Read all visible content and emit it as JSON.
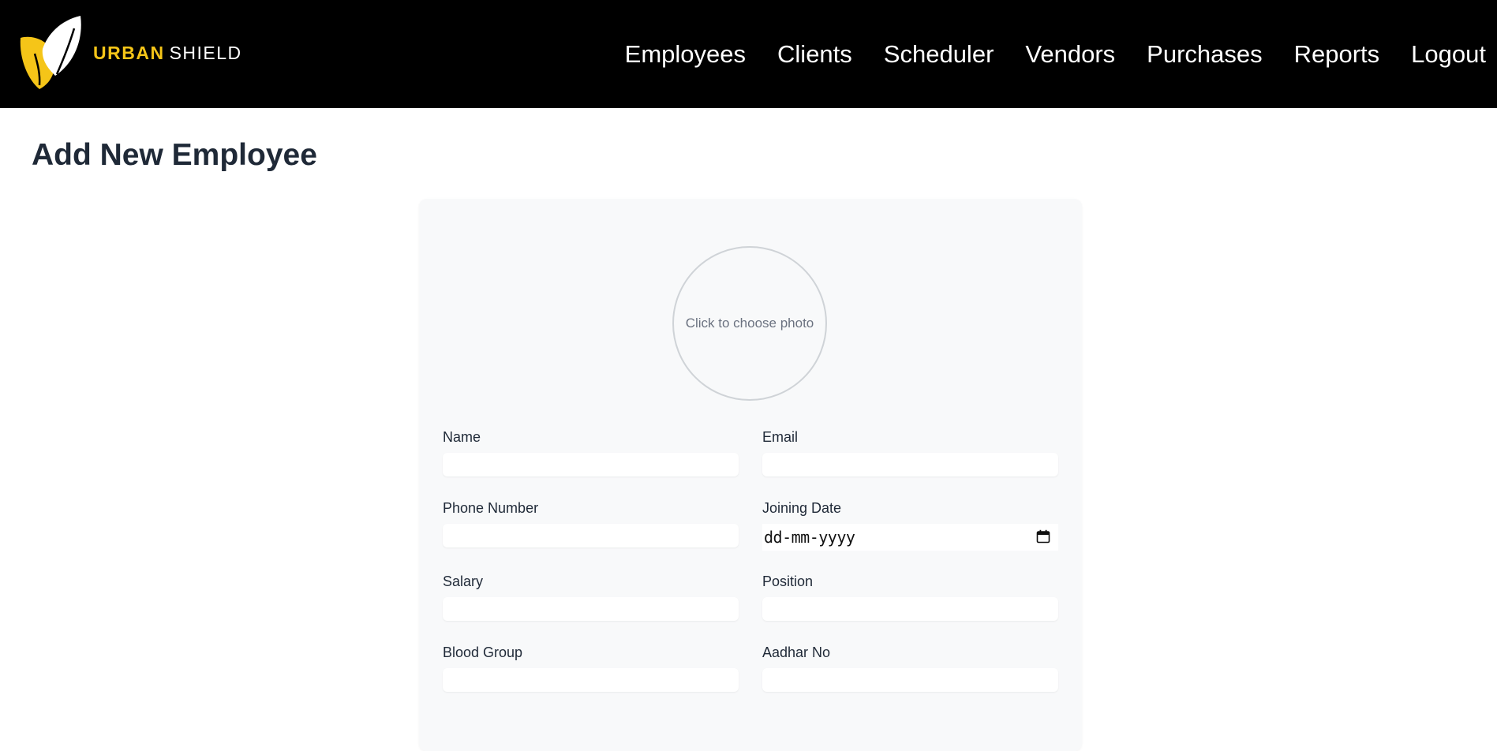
{
  "header": {
    "brand": {
      "word1": "URBAN",
      "word2": "SHIELD",
      "accent_color": "#f5c518"
    },
    "nav": [
      {
        "label": "Employees"
      },
      {
        "label": "Clients"
      },
      {
        "label": "Scheduler"
      },
      {
        "label": "Vendors"
      },
      {
        "label": "Purchases"
      },
      {
        "label": "Reports"
      },
      {
        "label": "Logout"
      }
    ]
  },
  "page": {
    "title": "Add New Employee"
  },
  "form": {
    "photo_prompt": "Click to choose photo",
    "fields": {
      "name": {
        "label": "Name",
        "value": ""
      },
      "email": {
        "label": "Email",
        "value": ""
      },
      "phone": {
        "label": "Phone Number",
        "value": ""
      },
      "joining_date": {
        "label": "Joining Date",
        "placeholder": "dd-mm-yyyy"
      },
      "salary": {
        "label": "Salary",
        "value": ""
      },
      "position": {
        "label": "Position",
        "value": ""
      },
      "blood_group": {
        "label": "Blood Group",
        "value": ""
      },
      "aadhar": {
        "label": "Aadhar No",
        "value": ""
      }
    }
  },
  "icons": {
    "logo": "leaf-logo-icon",
    "calendar": "calendar-icon"
  },
  "colors": {
    "navbar_bg": "#000000",
    "nav_text": "#ffffff",
    "title_text": "#1f2937",
    "card_bg": "#f8f9fa"
  }
}
